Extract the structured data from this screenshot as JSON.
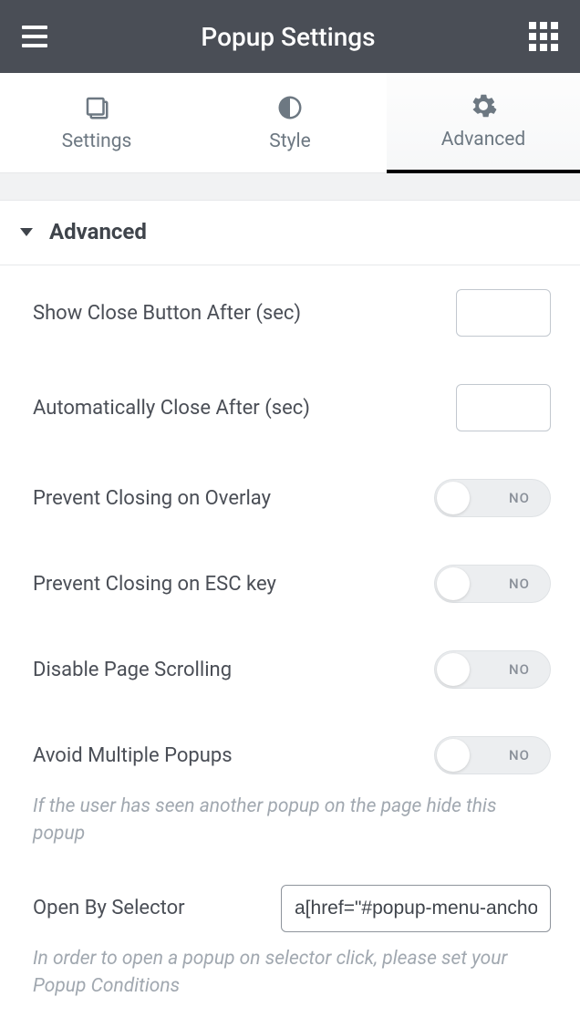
{
  "header": {
    "title": "Popup Settings"
  },
  "tabs": {
    "settings": "Settings",
    "style": "Style",
    "advanced": "Advanced"
  },
  "section": {
    "title": "Advanced"
  },
  "controls": {
    "show_close_after": {
      "label": "Show Close Button After (sec)",
      "value": ""
    },
    "auto_close_after": {
      "label": "Automatically Close After (sec)",
      "value": ""
    },
    "prevent_overlay": {
      "label": "Prevent Closing on Overlay",
      "state": "NO"
    },
    "prevent_esc": {
      "label": "Prevent Closing on ESC key",
      "state": "NO"
    },
    "disable_scroll": {
      "label": "Disable Page Scrolling",
      "state": "NO"
    },
    "avoid_multiple": {
      "label": "Avoid Multiple Popups",
      "state": "NO"
    },
    "avoid_multiple_help": "If the user has seen another popup on the page hide this popup",
    "open_by_selector": {
      "label": "Open By Selector",
      "value": "a[href=\"#popup-menu-anchor\"]"
    },
    "open_by_selector_help": "In order to open a popup on selector click, please set your Popup Conditions"
  }
}
